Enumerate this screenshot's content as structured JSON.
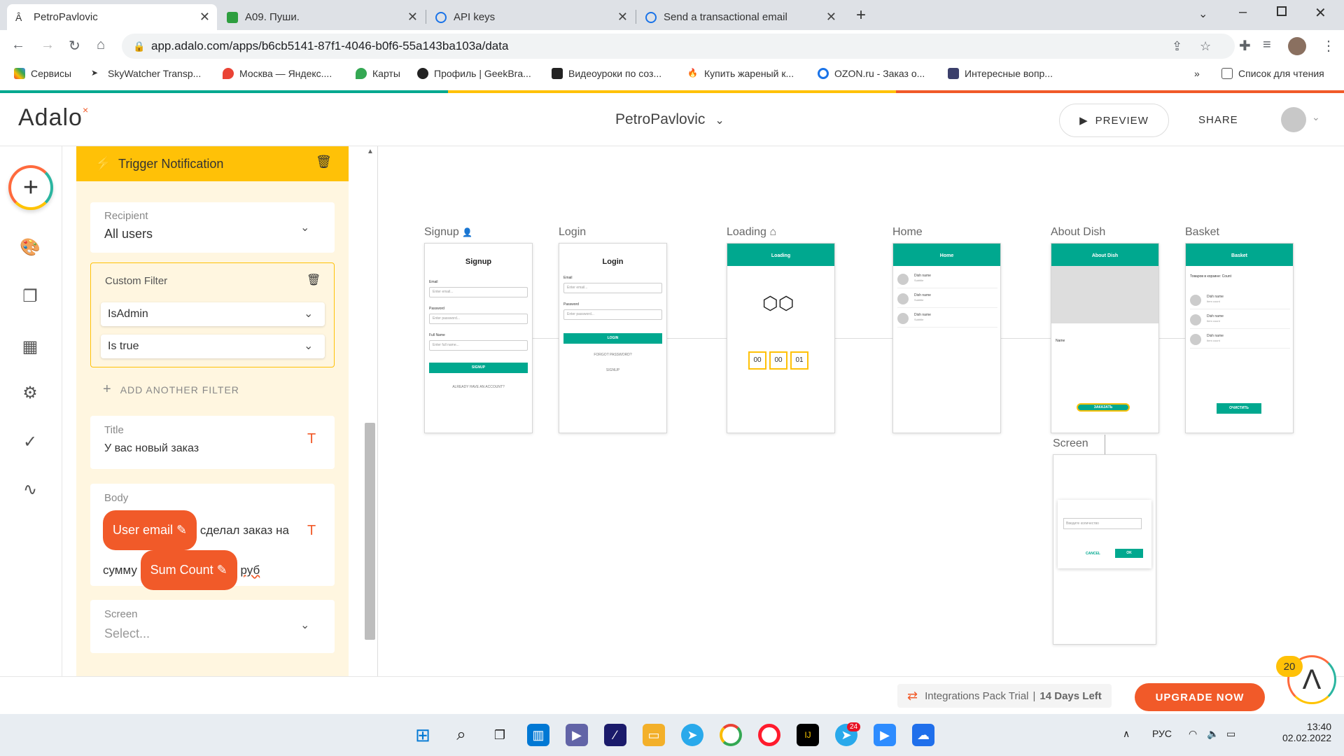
{
  "browser": {
    "tabs": [
      {
        "title": "PetroPavlovic",
        "color": "#444"
      },
      {
        "title": "A09. Пуши.",
        "color": "#2e9e3f"
      },
      {
        "title": "API keys",
        "color": "#1a73e8"
      },
      {
        "title": "Send a transactional email",
        "color": "#1a73e8"
      }
    ],
    "url": "app.adalo.com/apps/b6cb5141-87f1-4046-b0f6-55a143ba103a/data",
    "bookmarks": [
      "Сервисы",
      "SkyWatcher Transp...",
      "Москва — Яндекс....",
      "Карты",
      "Профиль | GeekBra...",
      "Видеоуроки по соз...",
      "Купить жареный к...",
      "OZON.ru - Заказ о...",
      "Интересные вопр..."
    ],
    "reading_list": "Список для чтения"
  },
  "app": {
    "logo": "Adalo",
    "app_name": "PetroPavlovic",
    "preview_label": "PREVIEW",
    "share_label": "SHARE"
  },
  "panel": {
    "header": "Trigger Notification",
    "recipient_label": "Recipient",
    "recipient_value": "All users",
    "custom_filter_label": "Custom Filter",
    "filter_field": "IsAdmin",
    "filter_condition": "Is true",
    "add_filter_label": "ADD ANOTHER FILTER",
    "title_label": "Title",
    "title_value": "У вас новый заказ",
    "body_label": "Body",
    "body_pill1": "User email",
    "body_text1": "сделал заказ",
    "body_text2": "на сумму",
    "body_pill2": "Sum Count",
    "body_text3": "руб",
    "screen_label": "Screen",
    "screen_placeholder": "Select..."
  },
  "screens": {
    "signup": {
      "label": "Signup",
      "title": "Signup",
      "email": "Email",
      "email_ph": "Enter email...",
      "password": "Password",
      "password_ph": "Enter password...",
      "fullname": "Full Name",
      "fullname_ph": "Enter full name...",
      "button": "SIGNUP",
      "link": "ALREADY HAVE AN ACCOUNT?"
    },
    "login": {
      "label": "Login",
      "title": "Login",
      "email": "Email",
      "email_ph": "Enter email...",
      "password": "Password",
      "password_ph": "Enter password...",
      "button": "LOGIN",
      "forgot": "FORGOT PASSWORD?",
      "signup": "SIGNUP"
    },
    "loading": {
      "label": "Loading",
      "bar": "Loading",
      "t1": "00",
      "t2": "00",
      "t3": "01"
    },
    "home": {
      "label": "Home",
      "bar": "Home",
      "item": "Dish name",
      "sub": "Subtitle"
    },
    "about": {
      "label": "About Dish",
      "bar": "About Dish",
      "name": "Name",
      "button": "ЗАКАЗАТЬ"
    },
    "basket": {
      "label": "Basket",
      "bar": "Basket",
      "heading": "Товаров в корзине: Count",
      "item": "Dish name",
      "sub": "Item count",
      "button": "ОЧИСТИТЬ"
    },
    "screen": {
      "label": "Screen",
      "input_ph": "Введите количество",
      "cancel": "CANCEL",
      "ok": "OK"
    }
  },
  "bottom": {
    "trial": "Integrations Pack Trial",
    "days": "14 Days Left",
    "upgrade": "UPGRADE NOW",
    "badge": "20"
  },
  "taskbar": {
    "lang": "РУС",
    "time": "13:40",
    "date": "02.02.2022",
    "telegram_badge": "24"
  },
  "colors": {
    "accent": "#f15a29",
    "panel_header": "#ffc107",
    "teal": "#00a88f"
  }
}
